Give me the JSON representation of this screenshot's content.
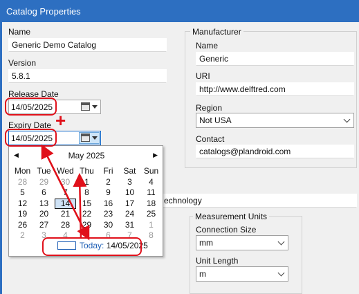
{
  "window": {
    "title": "Catalog Properties"
  },
  "fields": {
    "name_label": "Name",
    "name_value": "Generic Demo Catalog",
    "version_label": "Version",
    "version_value": "5.8.1",
    "release_label": "Release Date",
    "release_value": "14/05/2025",
    "expiry_label": "Expiry Date",
    "expiry_value": "14/05/2025",
    "hidden_text_value": "echnology"
  },
  "manufacturer": {
    "group_title": "Manufacturer",
    "name_label": "Name",
    "name_value": "Generic",
    "uri_label": "URI",
    "uri_value": "http://www.delftred.com",
    "region_label": "Region",
    "region_value": "Not USA",
    "contact_label": "Contact",
    "contact_value": "catalogs@plandroid.com"
  },
  "measurement": {
    "group_title": "Measurement Units",
    "connection_label": "Connection Size",
    "connection_value": "mm",
    "length_label": "Unit Length",
    "length_value": "m"
  },
  "annotation": {
    "plus_sign": "+",
    "color": "#e0101a"
  },
  "calendar": {
    "month_title": "May 2025",
    "prev_glyph": "◀",
    "next_glyph": "▶",
    "weekdays": [
      "Mon",
      "Tue",
      "Wed",
      "Thu",
      "Fri",
      "Sat",
      "Sun"
    ],
    "weeks": [
      [
        "28",
        "29",
        "30",
        "1",
        "2",
        "3",
        "4"
      ],
      [
        "5",
        "6",
        "7",
        "8",
        "9",
        "10",
        "11"
      ],
      [
        "12",
        "13",
        "14",
        "15",
        "16",
        "17",
        "18"
      ],
      [
        "19",
        "20",
        "21",
        "22",
        "23",
        "24",
        "25"
      ],
      [
        "26",
        "27",
        "28",
        "29",
        "30",
        "31",
        "1"
      ],
      [
        "2",
        "3",
        "4",
        "5",
        "6",
        "7",
        "8"
      ]
    ],
    "today_label": "Today:",
    "today_value": "14/05/2025"
  }
}
